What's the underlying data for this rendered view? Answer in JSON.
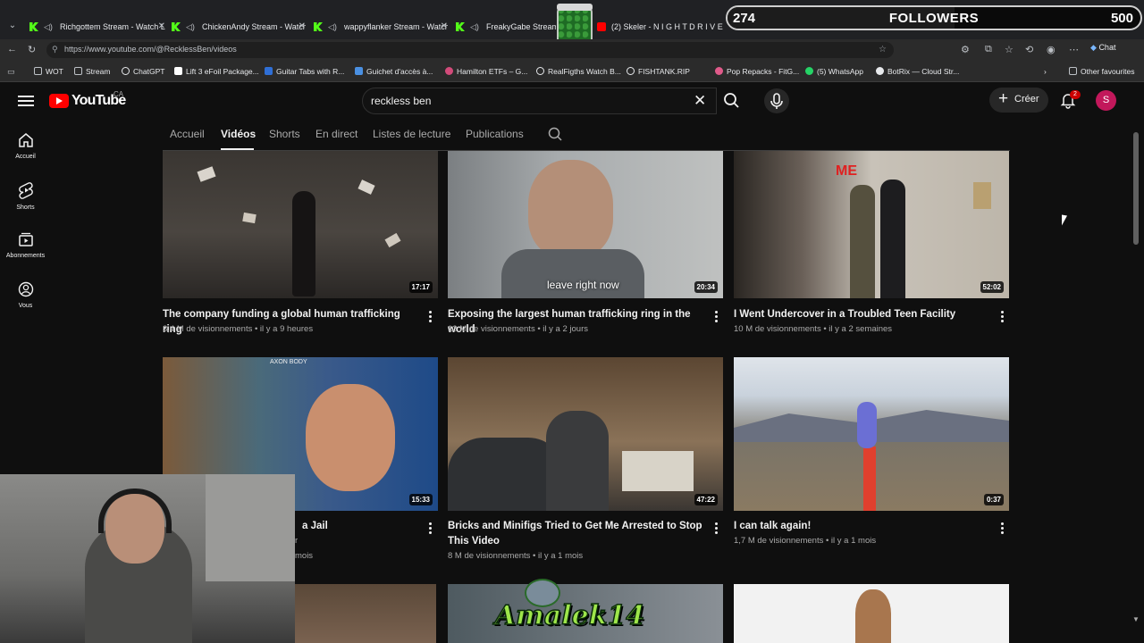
{
  "browser": {
    "tabs": [
      {
        "title": "Richgottem Stream - Watch L",
        "icon": "kick-icon"
      },
      {
        "title": "ChickenAndy Stream - Watch",
        "icon": "kick-icon"
      },
      {
        "title": "wappyflanker Stream - Watch",
        "icon": "kick-icon"
      },
      {
        "title": "FreakyGabe Stream - W",
        "icon": "kick-icon"
      },
      {
        "title": "(2) Skeler - N I G H T D R I V E",
        "icon": "youtube-icon"
      }
    ],
    "url": "https://www.youtube.com/@RecklessBen/videos",
    "chat_label": "Chat",
    "bookmarks": [
      {
        "label": "WOT",
        "icon": "folder-icon"
      },
      {
        "label": "Stream",
        "icon": "folder-icon"
      },
      {
        "label": "ChatGPT",
        "icon": "chatgpt-icon"
      },
      {
        "label": "Lift 3 eFoil Package...",
        "icon": "lift-icon"
      },
      {
        "label": "Guitar Tabs with R...",
        "icon": "guitar-icon"
      },
      {
        "label": "Guichet d'accès à...",
        "icon": "gov-icon"
      },
      {
        "label": "Hamilton ETFs – G...",
        "icon": "hamilton-icon"
      },
      {
        "label": "RealFigths Watch B...",
        "icon": "wordpress-icon"
      },
      {
        "label": "FISHTANK.RIP",
        "icon": "globe-icon"
      },
      {
        "label": "Pop Repacks - FitG...",
        "icon": "fitgirl-icon"
      },
      {
        "label": "(5) WhatsApp",
        "icon": "whatsapp-icon"
      },
      {
        "label": "BotRix — Cloud Str...",
        "icon": "botrix-icon"
      }
    ],
    "other_bookmarks": "Other favourites"
  },
  "overlay": {
    "followers_current": "274",
    "followers_label": "FOLLOWERS",
    "followers_goal": "500",
    "watermark": "Amalek14"
  },
  "youtube": {
    "logo_text": "YouTube",
    "region": "CA",
    "search_value": "reckless ben",
    "create_label": "Créer",
    "notifications": "2",
    "avatar_letter": "S",
    "rail": [
      {
        "label": "Accueil",
        "icon": "home-icon"
      },
      {
        "label": "Shorts",
        "icon": "shorts-icon"
      },
      {
        "label": "Abonnements",
        "icon": "subscriptions-icon"
      },
      {
        "label": "Vous",
        "icon": "you-icon"
      }
    ],
    "channel_tabs": [
      "Accueil",
      "Vidéos",
      "Shorts",
      "En direct",
      "Listes de lecture",
      "Publications"
    ],
    "active_tab": "Vidéos",
    "videos": [
      {
        "title": "The company funding a global human trafficking ring",
        "meta": "3,4 M de visionnements • il y a 9 heures",
        "duration": "17:17"
      },
      {
        "title": "Exposing the largest human trafficking ring in the world",
        "meta": "13 M de visionnements • il y a 2 jours",
        "duration": "20:34",
        "caption": "leave right now"
      },
      {
        "title": "I Went Undercover in a Troubled Teen Facility",
        "meta": "10 M de visionnements • il y a 2 semaines",
        "duration": "52:02",
        "caption": "ME"
      },
      {
        "title": "a Jail",
        "meta": "mois",
        "meta2": "r",
        "duration": "15:33"
      },
      {
        "title": "Bricks and Minifigs Tried to Get Me Arrested to Stop This Video",
        "meta": "8 M de visionnements • il y a 1 mois",
        "duration": "47:22"
      },
      {
        "title": "I can talk again!",
        "meta": "1,7 M de visionnements • il y a 1 mois",
        "duration": "0:37"
      }
    ]
  }
}
